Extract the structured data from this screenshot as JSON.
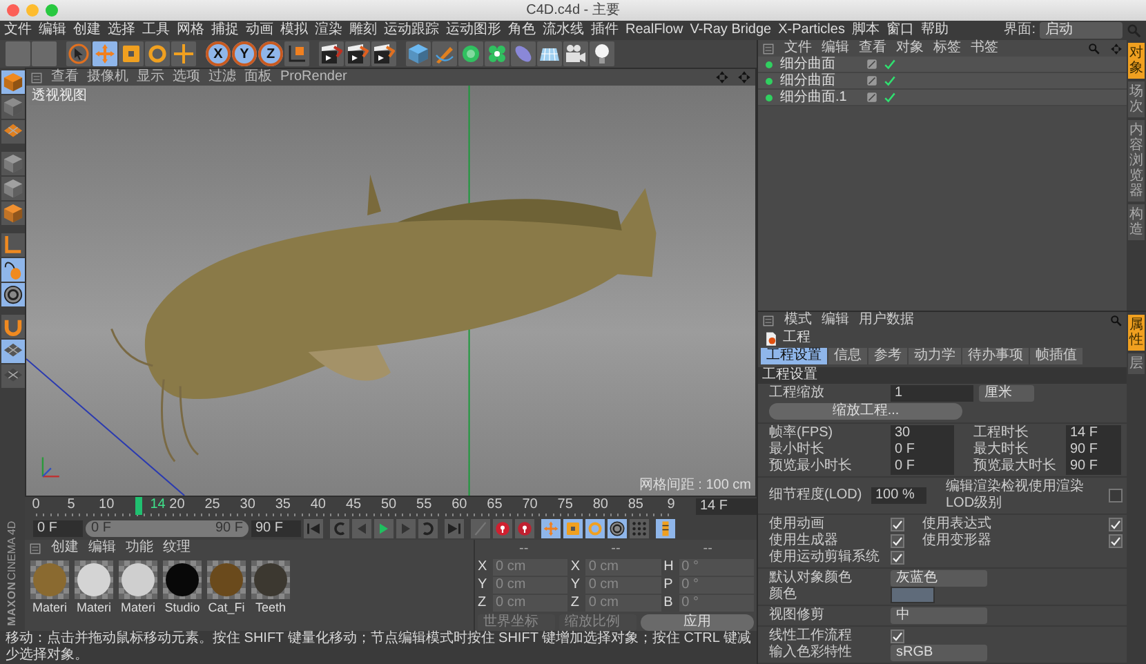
{
  "window": {
    "title": "C4D.c4d - 主要"
  },
  "menu_bar": [
    "文件",
    "编辑",
    "创建",
    "选择",
    "工具",
    "网格",
    "捕捉",
    "动画",
    "模拟",
    "渲染",
    "雕刻",
    "运动跟踪",
    "运动图形",
    "角色",
    "流水线",
    "插件",
    "RealFlow",
    "V-Ray Bridge",
    "X-Particles",
    "脚本",
    "窗口",
    "帮助"
  ],
  "layout_selector": {
    "label": "界面:",
    "value": "启动"
  },
  "toolbar": [
    {
      "kind": "blank"
    },
    {
      "kind": "blank"
    },
    {
      "kind": "icon",
      "selected": false
    },
    {
      "kind": "icon",
      "selected": true
    },
    {
      "kind": "icon",
      "selected": false
    },
    {
      "kind": "icon",
      "selected": false
    },
    {
      "kind": "icon",
      "selected": false
    },
    {
      "kind": "letter",
      "label": "X",
      "selected": true
    },
    {
      "kind": "letter",
      "label": "Y",
      "selected": true
    },
    {
      "kind": "letter",
      "label": "Z",
      "selected": true
    },
    {
      "kind": "icon",
      "selected": false
    },
    {
      "kind": "icon",
      "selected": false
    },
    {
      "kind": "icon",
      "selected": false
    },
    {
      "kind": "icon",
      "selected": false
    },
    {
      "kind": "icon",
      "selected": false
    },
    {
      "kind": "icon",
      "selected": false
    },
    {
      "kind": "icon",
      "selected": false
    },
    {
      "kind": "icon",
      "selected": false
    },
    {
      "kind": "icon",
      "selected": false
    },
    {
      "kind": "icon",
      "selected": false
    },
    {
      "kind": "icon",
      "selected": false
    },
    {
      "kind": "icon",
      "selected": false
    }
  ],
  "left_toolbar": [
    {
      "selected": true
    },
    {
      "selected": false
    },
    {
      "selected": false
    },
    {
      "selected": false
    },
    {
      "selected": false
    },
    {
      "selected": false
    },
    {
      "selected": false
    },
    {
      "selected": true
    },
    {
      "selected": true
    },
    {
      "selected": false
    },
    {
      "selected": true
    },
    {
      "selected": false
    }
  ],
  "viewport": {
    "menu": [
      "查看",
      "摄像机",
      "显示",
      "选项",
      "过滤",
      "面板",
      "ProRender"
    ],
    "view_label": "透视视图",
    "grid_spacing": "网格间距 : 100 cm"
  },
  "timeline": {
    "ticks": [
      "0",
      "5",
      "10",
      "20",
      "25",
      "30",
      "35",
      "40",
      "45",
      "50",
      "55",
      "60",
      "65",
      "70",
      "75",
      "80",
      "85",
      "9"
    ],
    "playhead": {
      "label": "14",
      "level": 0.156
    },
    "current_frame": "14 F"
  },
  "playback": {
    "start_field": "0 F",
    "range": {
      "start": "0 F",
      "end": "90 F",
      "level": 1
    },
    "end_field": "90 F",
    "controls": [
      {
        "selected": false
      },
      {
        "selected": false
      },
      {
        "selected": false
      },
      {
        "selected": false
      },
      {
        "selected": false
      },
      {
        "selected": false
      },
      {
        "selected": false
      },
      {
        "selected": false
      },
      {
        "selected": false
      },
      {
        "selected": false
      },
      {
        "selected": true
      },
      {
        "selected": true
      },
      {
        "selected": true
      },
      {
        "selected": true
      },
      {
        "selected": false
      },
      {
        "selected": true
      }
    ]
  },
  "materials": {
    "menu": [
      "创建",
      "编辑",
      "功能",
      "纹理"
    ],
    "items": [
      {
        "name": "Materi",
        "color": "#8a6a30"
      },
      {
        "name": "Materi",
        "color": "#d4d4d4"
      },
      {
        "name": "Materi",
        "color": "#cfcfcf"
      },
      {
        "name": "Studio",
        "color": "#080808"
      },
      {
        "name": "Cat_Fi",
        "color": "#6a4a1c"
      },
      {
        "name": "Teeth",
        "color": "#3c3830"
      }
    ]
  },
  "logo": {
    "brand": "MAXON",
    "product": "CINEMA 4D"
  },
  "coordinates": {
    "headers": [
      "--",
      "--",
      "--"
    ],
    "rows": [
      {
        "position_axis": "X",
        "position": "0 cm",
        "size_axis": "X",
        "size": "0 cm",
        "rotation_axis": "H",
        "rotation": "0 °"
      },
      {
        "position_axis": "Y",
        "position": "0 cm",
        "size_axis": "Y",
        "size": "0 cm",
        "rotation_axis": "P",
        "rotation": "0 °"
      },
      {
        "position_axis": "Z",
        "position": "0 cm",
        "size_axis": "Z",
        "size": "0 cm",
        "rotation_axis": "B",
        "rotation": "0 °"
      }
    ],
    "coordinate_system": "世界坐标",
    "size_mode": "缩放比例",
    "apply_button": "应用"
  },
  "status_bar": "移动：点击并拖动鼠标移动元素。按住 SHIFT 键量化移动；节点编辑模式时按住 SHIFT 键增加选择对象；按住 CTRL 键减少选择对象。",
  "object_manager": {
    "menu": [
      "文件",
      "编辑",
      "查看",
      "对象",
      "标签",
      "书签"
    ],
    "objects": [
      {
        "name": "细分曲面",
        "enabled": true
      },
      {
        "name": "细分曲面",
        "enabled": true
      },
      {
        "name": "细分曲面.1",
        "enabled": true
      }
    ],
    "side_tabs": [
      {
        "label": "对象",
        "selected": true
      },
      {
        "label": "场次",
        "selected": false
      },
      {
        "label": "内容浏览器",
        "selected": false
      },
      {
        "label": "构造",
        "selected": false
      }
    ]
  },
  "attributes": {
    "menu": [
      "模式",
      "编辑",
      "用户数据"
    ],
    "title": "工程",
    "tabs": [
      {
        "label": "工程设置",
        "selected": true
      },
      {
        "label": "信息",
        "selected": false
      },
      {
        "label": "参考",
        "selected": false
      },
      {
        "label": "动力学",
        "selected": false
      },
      {
        "label": "待办事项",
        "selected": false
      },
      {
        "label": "帧插值",
        "selected": false
      }
    ],
    "section": "工程设置",
    "groups": [
      [
        {
          "kind": "scale",
          "label": "工程缩放",
          "value": "1",
          "unit": "厘米"
        },
        {
          "kind": "button",
          "label": "缩放工程..."
        }
      ],
      [
        {
          "kind": "pair",
          "left": {
            "label": "帧率(FPS)",
            "value": "30"
          },
          "right": {
            "label": "工程时长",
            "value": "14 F"
          }
        },
        {
          "kind": "pair",
          "left": {
            "label": "最小时长",
            "value": "0 F"
          },
          "right": {
            "label": "最大时长",
            "value": "90 F"
          }
        },
        {
          "kind": "pair",
          "left": {
            "label": "预览最小时长",
            "value": "0 F"
          },
          "right": {
            "label": "预览最大时长",
            "value": "90 F"
          }
        }
      ],
      [
        {
          "kind": "lod",
          "label": "细节程度(LOD)",
          "value": "100 %",
          "option": {
            "label": "编辑渲染检视使用渲染LOD级别",
            "checked": false
          }
        }
      ],
      [
        {
          "kind": "checks",
          "left": {
            "label": "使用动画",
            "checked": true
          },
          "right": {
            "label": "使用表达式",
            "checked": true
          }
        },
        {
          "kind": "checks",
          "left": {
            "label": "使用生成器",
            "checked": true
          },
          "right": {
            "label": "使用变形器",
            "checked": true
          }
        },
        {
          "kind": "checks",
          "left": {
            "label": "使用运动剪辑系统",
            "checked": true
          }
        }
      ],
      [
        {
          "kind": "dropdown",
          "label": "默认对象颜色",
          "value": "灰蓝色"
        },
        {
          "kind": "color",
          "label": "颜色",
          "color": "#5f6b7a"
        }
      ],
      [
        {
          "kind": "dropdown",
          "label": "视图修剪",
          "value": "中"
        }
      ],
      [
        {
          "kind": "check",
          "label": "线性工作流程",
          "checked": true
        },
        {
          "kind": "dropdown",
          "label": "输入色彩特性",
          "value": "sRGB"
        }
      ]
    ],
    "side_tabs": [
      {
        "label": "属性",
        "selected": true
      },
      {
        "label": "层",
        "selected": false
      }
    ]
  }
}
